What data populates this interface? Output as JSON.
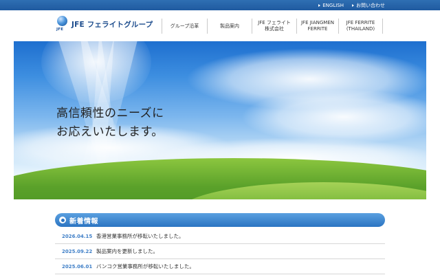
{
  "topbar": {
    "links": [
      {
        "label": "ENGLISH"
      },
      {
        "label": "お問い合わせ"
      }
    ]
  },
  "header": {
    "logo_mark_text": "JFE",
    "logo_text": "JFE フェライトグループ",
    "nav": [
      {
        "label": "グループ沿革"
      },
      {
        "label": "製品案内"
      },
      {
        "label": "JFE フェライト\n株式会社"
      },
      {
        "label": "JFE JIANGMEN\nFERRITE"
      },
      {
        "label": "JFE FERRITE\n(THAILAND)"
      }
    ]
  },
  "hero": {
    "headline": "高信頼性のニーズに\nお応えいたします。"
  },
  "news": {
    "title": "新着情報",
    "items": [
      {
        "date": "2026.04.15",
        "text": "香港営業事務所が移転いたしました。"
      },
      {
        "date": "2025.09.22",
        "text": "製品案内を更新しました。"
      },
      {
        "date": "2025.06.01",
        "text": "バンコク営業事務所が移転いたしました。"
      }
    ]
  }
}
